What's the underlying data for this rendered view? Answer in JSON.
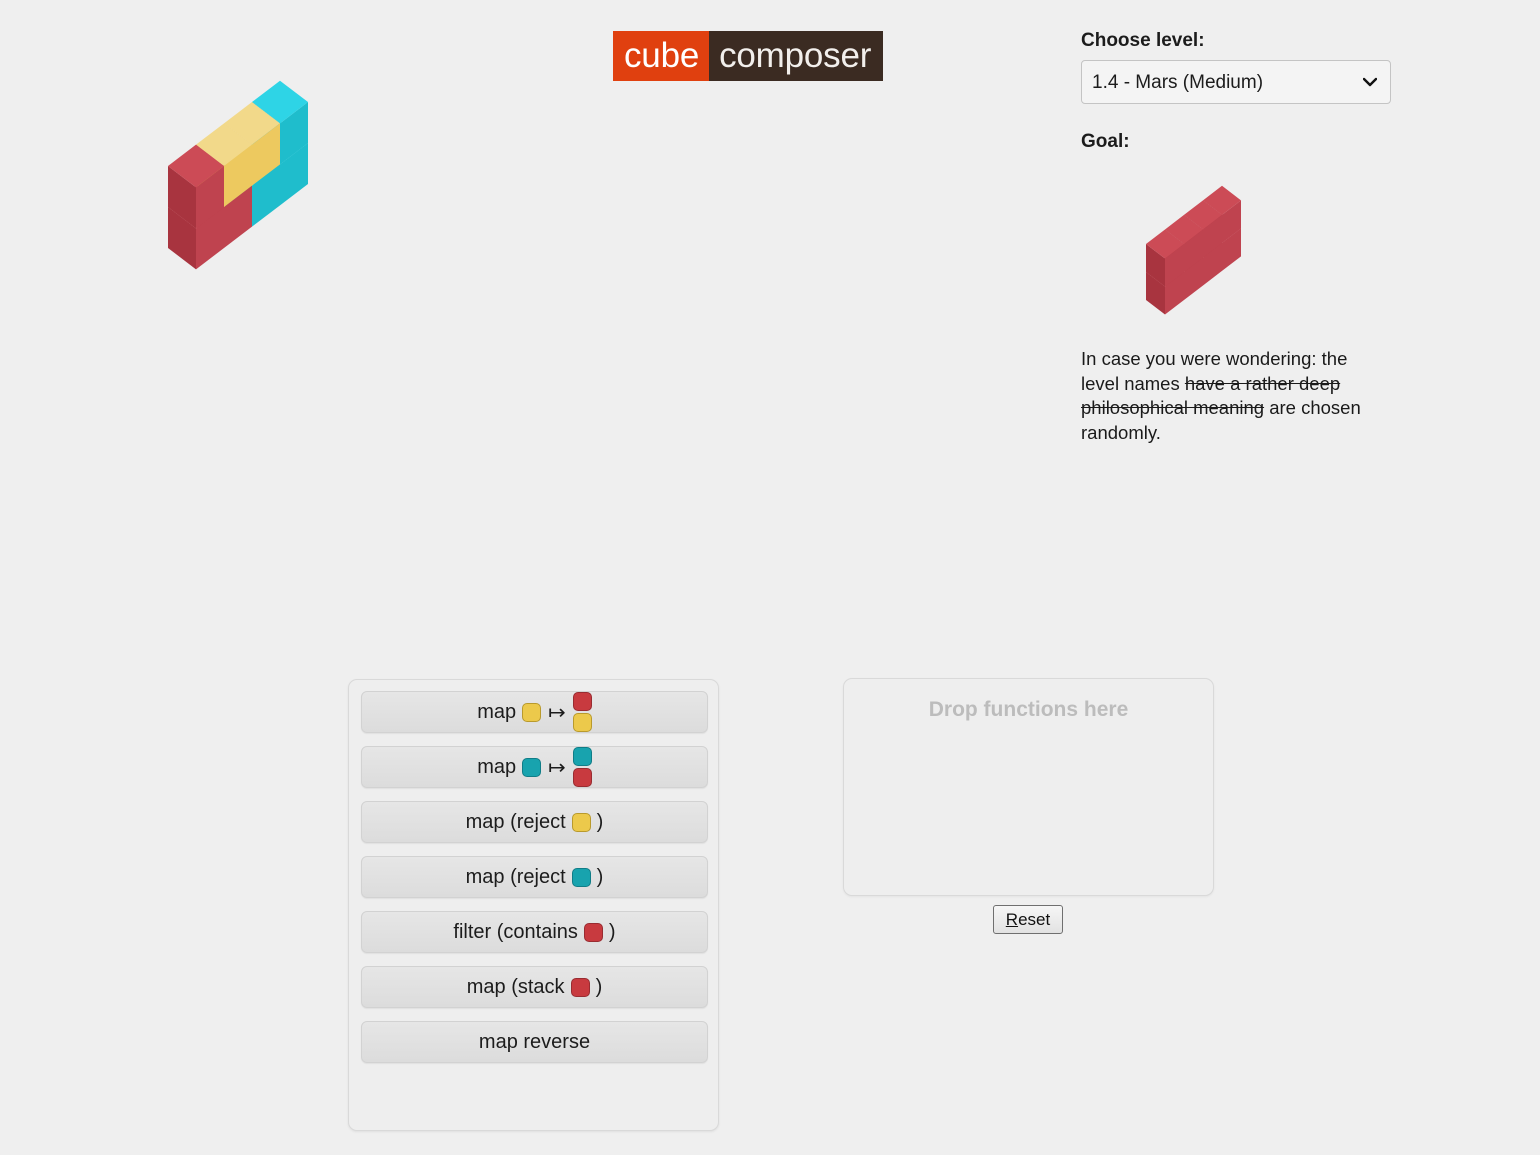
{
  "app": {
    "logo_left": "cube",
    "logo_right": "composer"
  },
  "controls": {
    "level_label": "Choose level:",
    "level_selected": "1.4 - Mars (Medium)",
    "level_options": [
      "1.4 - Mars (Medium)"
    ],
    "chevron_icon": "chevron-down-icon",
    "goal_label": "Goal:"
  },
  "note": {
    "part1": "In case you were wondering: the level names ",
    "struck": "have a rather deep philosophical meaning",
    "part2": " are chosen randomly."
  },
  "colors": {
    "background": "#efefef",
    "logo_orange": "#e0400f",
    "logo_brown": "#3b2b22",
    "red_top": "#cc4b56",
    "red_left": "#a8343f",
    "red_right": "#bf434f",
    "yellow_top": "#f2d98a",
    "yellow_left": "#e6bf4e",
    "yellow_right": "#edc95f",
    "cyan_top": "#2ed4e6",
    "cyan_left": "#17a3b3",
    "cyan_right": "#1fbdcc",
    "swatch_yellow": "#ecc94b",
    "swatch_cyan": "#18a3ae",
    "swatch_red": "#c83a3f"
  },
  "current_stack": {
    "name": "current-cube-stage",
    "columns": [
      [
        "red",
        "red"
      ],
      [
        "red",
        "yellow"
      ],
      [
        "cyan",
        "yellow"
      ],
      [
        "cyan",
        "cyan"
      ]
    ]
  },
  "goal_stack": {
    "name": "goal-cube-stage",
    "columns": [
      [
        "red",
        "red"
      ],
      [
        "red",
        "red"
      ],
      [
        "red",
        "red"
      ],
      [
        "red",
        "red"
      ]
    ]
  },
  "functions": {
    "panel_name": "function-list",
    "items": [
      {
        "id": "map-yellow-to-red-yellow",
        "prefix": "map",
        "arg": "yellow",
        "arrow": "↦",
        "result": [
          "red",
          "yellow"
        ]
      },
      {
        "id": "map-cyan-to-cyan-red",
        "prefix": "map",
        "arg": "cyan",
        "arrow": "↦",
        "result": [
          "cyan",
          "red"
        ]
      },
      {
        "id": "map-reject-yellow",
        "prefix": "map (reject",
        "arg": "yellow",
        "suffix": ")"
      },
      {
        "id": "map-reject-cyan",
        "prefix": "map (reject",
        "arg": "cyan",
        "suffix": ")"
      },
      {
        "id": "filter-contains-red",
        "prefix": "filter (contains",
        "arg": "red",
        "suffix": ")"
      },
      {
        "id": "map-stack-red",
        "prefix": "map (stack",
        "arg": "red",
        "suffix": ")"
      },
      {
        "id": "map-reverse",
        "prefix": "map reverse"
      }
    ]
  },
  "drop": {
    "hint": "Drop functions here",
    "reset_accesskey": "R",
    "reset_rest": "eset"
  }
}
